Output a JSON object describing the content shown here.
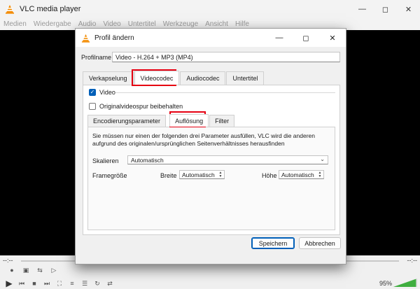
{
  "vlc": {
    "title": "VLC media player",
    "menu": [
      "Medien",
      "Wiedergabe",
      "Audio",
      "Video",
      "Untertitel",
      "Werkzeuge",
      "Ansicht",
      "Hilfe"
    ],
    "time_left": "--:--",
    "time_right": "--:--",
    "volume": "95%",
    "volume_level": 0.95
  },
  "dialog": {
    "title": "Profil ändern",
    "profile_label": "Profilname",
    "profile_value": "Video - H.264 + MP3 (MP4)",
    "tabs": [
      "Verkapselung",
      "Videocodec",
      "Audiocodec",
      "Untertitel"
    ],
    "video_checkbox_label": "Video",
    "video_checked": true,
    "keep_original_label": "Originalvideospur beibehalten",
    "keep_original_checked": false,
    "inner_tabs": [
      "Encodierungsparameter",
      "Auflösung",
      "Filter"
    ],
    "description": "Sie müssen nur einen der folgenden drei Parameter ausfüllen, VLC wird die anderen aufgrund des originalen/ursprünglichen Seitenverhältnisses herausfinden",
    "scale_label": "Skalieren",
    "scale_value": "Automatisch",
    "framesize_label": "Framegröße",
    "width_label": "Breite",
    "width_value": "Automatisch",
    "height_label": "Höhe",
    "height_value": "Automatisch",
    "save_label": "Speichern",
    "cancel_label": "Abbrechen"
  },
  "colors": {
    "highlight": "#e60012",
    "accent": "#005fb8"
  }
}
